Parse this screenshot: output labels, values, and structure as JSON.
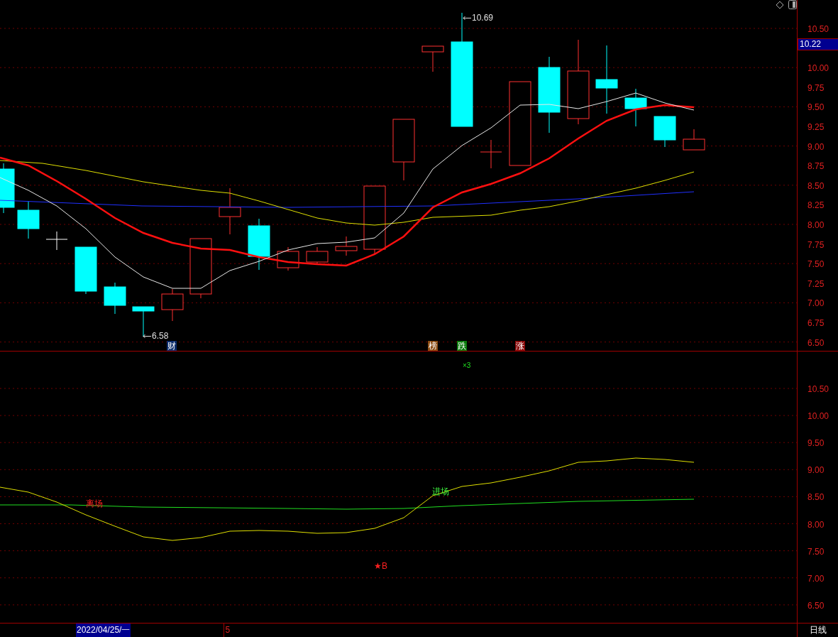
{
  "main_chart": {
    "high_label": "10.69",
    "low_label": "6.58",
    "current_price": "10.22",
    "price_axis": [
      "10.50",
      "10.00",
      "9.75",
      "9.50",
      "9.25",
      "9.00",
      "8.75",
      "8.50",
      "8.25",
      "8.00",
      "7.75",
      "7.50",
      "7.25",
      "7.00",
      "6.75",
      "6.50"
    ],
    "event_tags": [
      {
        "text": "财",
        "color": "#0a2a6a"
      },
      {
        "text": "榜",
        "color": "#8a4a10"
      },
      {
        "text": "跌",
        "color": "#0a7a0a"
      },
      {
        "text": "涨",
        "color": "#8a0a0a"
      }
    ]
  },
  "indicator_chart": {
    "multiplier": "×3",
    "buy_marker": "★B",
    "axis": [
      "10.50",
      "10.00",
      "9.50",
      "9.00",
      "8.50",
      "8.00",
      "7.50",
      "7.00",
      "6.50"
    ],
    "signals": [
      {
        "text": "离场",
        "kind": "exit"
      },
      {
        "text": "进场",
        "kind": "entry"
      }
    ]
  },
  "status_bar": {
    "date": "2022/04/25/一",
    "count": "5",
    "period": "日线"
  }
}
